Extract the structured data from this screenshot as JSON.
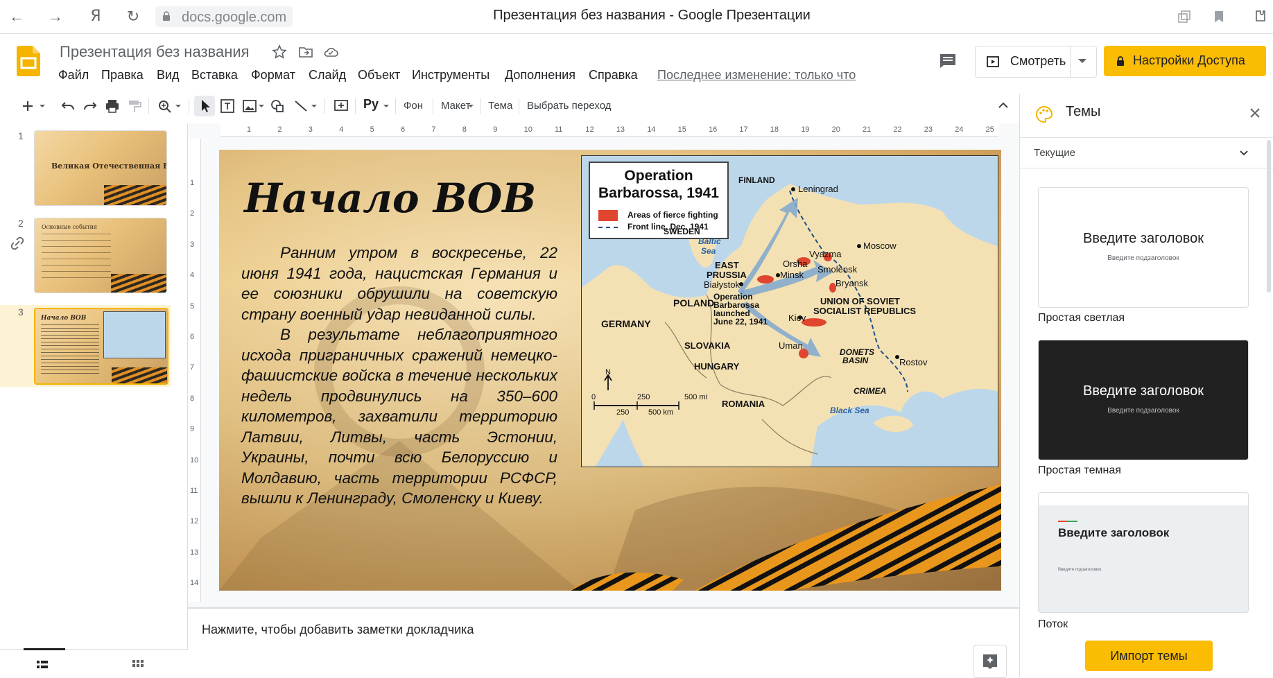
{
  "browser": {
    "url": "docs.google.com",
    "tab_title": "Презентация без названия - Google Презентации",
    "back_icon": "arrow-left-icon",
    "yandex_glyph": "Я"
  },
  "docs": {
    "title": "Презентация без названия",
    "menu": [
      "Файл",
      "Правка",
      "Вид",
      "Вставка",
      "Формат",
      "Слайд",
      "Объект",
      "Инструменты",
      "Дополнения",
      "Справка"
    ],
    "last_edit": "Последнее изменение: только что",
    "watch_label": "Смотреть",
    "access_label": "Настройки Доступа",
    "accent_color": "#fbbc04"
  },
  "toolbar": {
    "background_label": "Фон",
    "layout_label": "Макет",
    "theme_label": "Тема",
    "transition_label": "Выбрать переход"
  },
  "rulers": {
    "top": [
      "1",
      "2",
      "3",
      "4",
      "5",
      "6",
      "7",
      "8",
      "9",
      "10",
      "11",
      "12",
      "13",
      "14",
      "15",
      "16",
      "17",
      "18",
      "19",
      "20",
      "21",
      "22",
      "23",
      "24",
      "25"
    ],
    "left": [
      "1",
      "2",
      "3",
      "4",
      "5",
      "6",
      "7",
      "8",
      "9",
      "10",
      "11",
      "12",
      "13",
      "14"
    ]
  },
  "thumbnails": [
    {
      "number": "1",
      "title": "Великая Отечественная Война"
    },
    {
      "number": "2",
      "title": "Основные события"
    },
    {
      "number": "3",
      "title": "Начало ВОВ"
    }
  ],
  "slide": {
    "title": "Начало ВОВ",
    "paragraphs": [
      "Ранним утром в воскресенье, 22 июня 1941 года, нацистская Германия и ее союзники обрушили на советскую страну военный удар невиданной силы.",
      "В результате неблагоприятного исхода приграничных сражений немецко-фашистские войска в течение нескольких недель продвинулись на 350–600 километров, захватили территорию Латвии, Литвы, часть Эстонии, Украины, почти всю Белоруссию и Молдавию, часть территории РСФСР, вышли к Ленинграду, Смоленску и Киеву."
    ],
    "map": {
      "legend_title_line1": "Operation",
      "legend_title_line2": "Barbarossa, 1941",
      "legend_fighting": "Areas of fierce fighting",
      "legend_front": "Front line, Dec. 1941",
      "labels": {
        "finland": "FINLAND",
        "leningrad": "Leningrad",
        "sweden": "SWEDEN",
        "baltic_sea_1": "Baltic",
        "baltic_sea_2": "Sea",
        "moscow": "Moscow",
        "vyazma": "Vyazma",
        "orsha": "Orsha",
        "smolensk": "Smolensk",
        "minsk": "Minsk",
        "east_prussia_1": "EAST",
        "east_prussia_2": "PRUSSIA",
        "bialystok": "Białystok",
        "bryansk": "Bryansk",
        "poland": "POLAND",
        "op_1": "Operation",
        "op_2": "Barbarossa",
        "op_3": "launched",
        "op_4": "June 22, 1941",
        "ussr_1": "UNION OF SOVIET",
        "ussr_2": "SOCIALIST REPUBLICS",
        "germany": "GERMANY",
        "kiev": "Kiev",
        "slovakia": "SLOVAKIA",
        "uman": "Uman",
        "donets_1": "DONETS",
        "donets_2": "BASIN",
        "rostov": "Rostov",
        "hungary": "HUNGARY",
        "crimea": "CRIMEA",
        "romania": "ROMANIA",
        "black_sea": "Black Sea",
        "north": "N",
        "scale_mi_0": "0",
        "scale_mi_250": "250",
        "scale_mi_500": "500 mi",
        "scale_km_250": "250",
        "scale_km_500": "500 km"
      }
    }
  },
  "notes": {
    "placeholder": "Нажмите, чтобы добавить заметки докладчика"
  },
  "themes": {
    "title": "Темы",
    "current_label": "Текущие",
    "cards": [
      {
        "name": "Простая светлая",
        "title": "Введите заголовок",
        "subtitle": "Введите подзаголовок"
      },
      {
        "name": "Простая темная",
        "title": "Введите заголовок",
        "subtitle": "Введите подзаголовок"
      },
      {
        "name": "Поток",
        "title": "Введите заголовок",
        "subtitle": "Введите подзаголовок"
      }
    ],
    "import_label": "Импорт темы"
  }
}
